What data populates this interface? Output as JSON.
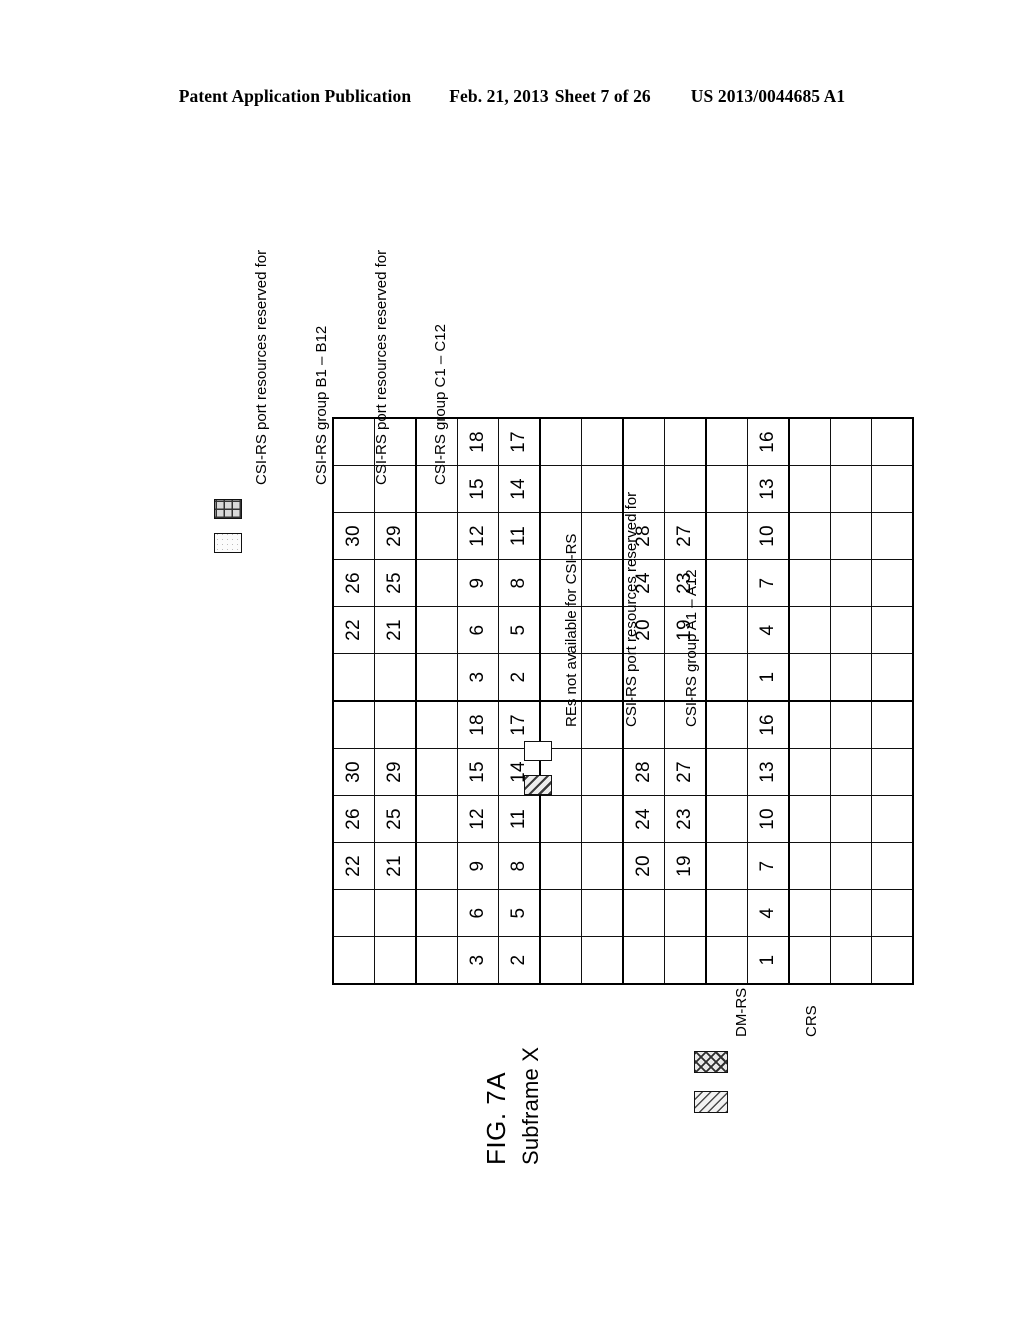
{
  "header": {
    "publication": "Patent Application Publication",
    "date": "Feb. 21, 2013",
    "sheet": "Sheet 7 of 26",
    "patent_number": "US 2013/0044685 A1"
  },
  "figure": {
    "label": "FIG. 7A",
    "subtitle": "Subframe X"
  },
  "legends": {
    "bc_group": {
      "lines": [
        "CSI-RS port resources reserved for",
        "CSI-RS group B1 – B12",
        "CSI-RS port resources reserved for",
        "CSI-RS group C1 – C12"
      ],
      "swatch_b": "light-speckle-swatch",
      "swatch_c": "fine-grid-swatch"
    },
    "na_group": {
      "lines": [
        "REs not available for CSI-RS",
        "CSI-RS port resources reserved for",
        "CSI-RS group A1 – A12"
      ],
      "swatch_na": "bold-diagonal-hatch-swatch",
      "swatch_a": "plain-white-swatch"
    },
    "reference_signals": {
      "items": [
        {
          "label": "DM-RS",
          "swatch": "diagonal-hatch-swatch"
        },
        {
          "label": "CRS",
          "swatch": "cross-hatch-swatch"
        }
      ]
    }
  },
  "grid": {
    "columns": 12,
    "rows_count": 14,
    "rows": [
      {
        "cells": [
          {
            "t": "",
            "p": "dmrs"
          },
          {
            "t": "",
            "p": "dmrs"
          },
          {
            "t": "22",
            "p": "plain"
          },
          {
            "t": "26",
            "p": "plain"
          },
          {
            "t": "30",
            "p": "plain"
          },
          {
            "t": "",
            "p": "dmrs"
          },
          {
            "t": "",
            "p": "dmrs"
          },
          {
            "t": "22",
            "p": "plain"
          },
          {
            "t": "26",
            "p": "plain"
          },
          {
            "t": "30",
            "p": "plain"
          },
          {
            "t": "",
            "p": "dmrs"
          },
          {
            "t": "",
            "p": "dmrs"
          }
        ]
      },
      {
        "cells": [
          {
            "t": "",
            "p": "dmrs"
          },
          {
            "t": "",
            "p": "dmrs"
          },
          {
            "t": "21",
            "p": "plain"
          },
          {
            "t": "25",
            "p": "plain"
          },
          {
            "t": "29",
            "p": "plain"
          },
          {
            "t": "",
            "p": "dmrs"
          },
          {
            "t": "",
            "p": "dmrs"
          },
          {
            "t": "21",
            "p": "plain"
          },
          {
            "t": "25",
            "p": "plain"
          },
          {
            "t": "29",
            "p": "plain"
          },
          {
            "t": "",
            "p": "dmrs"
          },
          {
            "t": "",
            "p": "dmrs"
          }
        ]
      },
      {
        "cells": [
          {
            "t": "",
            "p": "plain"
          },
          {
            "t": "",
            "p": "crs"
          },
          {
            "t": "",
            "p": "plain"
          },
          {
            "t": "",
            "p": "plain"
          },
          {
            "t": "",
            "p": "crs"
          },
          {
            "t": "",
            "p": "plain"
          },
          {
            "t": "",
            "p": "plain"
          },
          {
            "t": "",
            "p": "crs"
          },
          {
            "t": "",
            "p": "plain"
          },
          {
            "t": "",
            "p": "plain"
          },
          {
            "t": "",
            "p": "crs"
          },
          {
            "t": "",
            "p": "plain"
          }
        ]
      },
      {
        "cells": [
          {
            "t": "3",
            "p": "plain"
          },
          {
            "t": "6",
            "p": "plain"
          },
          {
            "t": "9",
            "p": "plain"
          },
          {
            "t": "12",
            "p": "plain"
          },
          {
            "t": "15",
            "p": "plain"
          },
          {
            "t": "18",
            "p": "plain"
          },
          {
            "t": "3",
            "p": "plain"
          },
          {
            "t": "6",
            "p": "plain"
          },
          {
            "t": "9",
            "p": "plain"
          },
          {
            "t": "12",
            "p": "plain"
          },
          {
            "t": "15",
            "p": "plain"
          },
          {
            "t": "18",
            "p": "plain"
          }
        ]
      },
      {
        "cells": [
          {
            "t": "2",
            "p": "plain"
          },
          {
            "t": "5",
            "p": "plain"
          },
          {
            "t": "8",
            "p": "plain"
          },
          {
            "t": "11",
            "p": "plain"
          },
          {
            "t": "14",
            "p": "plain"
          },
          {
            "t": "17",
            "p": "plain"
          },
          {
            "t": "2",
            "p": "plain"
          },
          {
            "t": "5",
            "p": "plain"
          },
          {
            "t": "8",
            "p": "plain"
          },
          {
            "t": "11",
            "p": "plain"
          },
          {
            "t": "14",
            "p": "plain"
          },
          {
            "t": "17",
            "p": "plain"
          }
        ]
      },
      {
        "cells": [
          {
            "t": "",
            "p": "plain"
          },
          {
            "t": "",
            "p": "crs"
          },
          {
            "t": "",
            "p": "plain"
          },
          {
            "t": "",
            "p": "plain"
          },
          {
            "t": "",
            "p": "crs"
          },
          {
            "t": "",
            "p": "plain"
          },
          {
            "t": "",
            "p": "plain"
          },
          {
            "t": "",
            "p": "crs"
          },
          {
            "t": "",
            "p": "plain"
          },
          {
            "t": "",
            "p": "plain"
          },
          {
            "t": "",
            "p": "crs"
          },
          {
            "t": "",
            "p": "plain"
          }
        ]
      },
      {
        "cells": [
          {
            "t": "",
            "p": "tint"
          },
          {
            "t": "",
            "p": "crs"
          },
          {
            "t": "",
            "p": "tint"
          },
          {
            "t": "",
            "p": "tint"
          },
          {
            "t": "",
            "p": "crs"
          },
          {
            "t": "",
            "p": "tint"
          },
          {
            "t": "",
            "p": "tint"
          },
          {
            "t": "",
            "p": "crs"
          },
          {
            "t": "",
            "p": "tint"
          },
          {
            "t": "",
            "p": "tint"
          },
          {
            "t": "",
            "p": "crs"
          },
          {
            "t": "",
            "p": "tint"
          }
        ]
      },
      {
        "cells": [
          {
            "t": "",
            "p": "na"
          },
          {
            "t": "",
            "p": "na"
          },
          {
            "t": "20",
            "p": "plain"
          },
          {
            "t": "24",
            "p": "plain"
          },
          {
            "t": "28",
            "p": "plain"
          },
          {
            "t": "",
            "p": "na"
          },
          {
            "t": "",
            "p": "na"
          },
          {
            "t": "20",
            "p": "plain"
          },
          {
            "t": "24",
            "p": "plain"
          },
          {
            "t": "28",
            "p": "plain"
          },
          {
            "t": "",
            "p": "na"
          },
          {
            "t": "",
            "p": "na"
          }
        ]
      },
      {
        "cells": [
          {
            "t": "",
            "p": "na"
          },
          {
            "t": "",
            "p": "na"
          },
          {
            "t": "19",
            "p": "plain"
          },
          {
            "t": "23",
            "p": "plain"
          },
          {
            "t": "27",
            "p": "plain"
          },
          {
            "t": "",
            "p": "na"
          },
          {
            "t": "",
            "p": "na"
          },
          {
            "t": "19",
            "p": "plain"
          },
          {
            "t": "23",
            "p": "plain"
          },
          {
            "t": "27",
            "p": "plain"
          },
          {
            "t": "",
            "p": "na"
          },
          {
            "t": "",
            "p": "na"
          }
        ]
      },
      {
        "cells": [
          {
            "t": "",
            "p": "plain"
          },
          {
            "t": "",
            "p": "crs"
          },
          {
            "t": "",
            "p": "plain"
          },
          {
            "t": "",
            "p": "plain"
          },
          {
            "t": "",
            "p": "crs"
          },
          {
            "t": "",
            "p": "plain"
          },
          {
            "t": "",
            "p": "plain"
          },
          {
            "t": "",
            "p": "crs"
          },
          {
            "t": "",
            "p": "plain"
          },
          {
            "t": "",
            "p": "plain"
          },
          {
            "t": "",
            "p": "crs"
          },
          {
            "t": "",
            "p": "plain"
          }
        ]
      },
      {
        "cells": [
          {
            "t": "1",
            "p": "plain"
          },
          {
            "t": "4",
            "p": "plain"
          },
          {
            "t": "7",
            "p": "plain"
          },
          {
            "t": "10",
            "p": "plain"
          },
          {
            "t": "13",
            "p": "plain"
          },
          {
            "t": "16",
            "p": "plain"
          },
          {
            "t": "1",
            "p": "plain"
          },
          {
            "t": "4",
            "p": "plain"
          },
          {
            "t": "7",
            "p": "plain"
          },
          {
            "t": "10",
            "p": "plain"
          },
          {
            "t": "13",
            "p": "plain"
          },
          {
            "t": "16",
            "p": "plain"
          }
        ]
      },
      {
        "cells": [
          {
            "t": "",
            "p": "tint"
          },
          {
            "t": "",
            "p": "tint"
          },
          {
            "t": "",
            "p": "tint"
          },
          {
            "t": "",
            "p": "tint"
          },
          {
            "t": "",
            "p": "tint"
          },
          {
            "t": "",
            "p": "tint"
          },
          {
            "t": "",
            "p": "tint"
          },
          {
            "t": "",
            "p": "tint"
          },
          {
            "t": "",
            "p": "tint"
          },
          {
            "t": "",
            "p": "tint"
          },
          {
            "t": "",
            "p": "tint"
          },
          {
            "t": "",
            "p": "tint"
          }
        ]
      },
      {
        "cells": [
          {
            "t": "",
            "p": "tint"
          },
          {
            "t": "",
            "p": "crs"
          },
          {
            "t": "",
            "p": "tint"
          },
          {
            "t": "",
            "p": "tint"
          },
          {
            "t": "",
            "p": "crs"
          },
          {
            "t": "",
            "p": "tint"
          },
          {
            "t": "",
            "p": "tint"
          },
          {
            "t": "",
            "p": "crs"
          },
          {
            "t": "",
            "p": "tint"
          },
          {
            "t": "",
            "p": "tint"
          },
          {
            "t": "",
            "p": "crs"
          },
          {
            "t": "",
            "p": "tint"
          }
        ]
      },
      {
        "cells": [
          {
            "t": "",
            "p": "tint"
          },
          {
            "t": "",
            "p": "crs"
          },
          {
            "t": "",
            "p": "tint"
          },
          {
            "t": "",
            "p": "tint"
          },
          {
            "t": "",
            "p": "crs"
          },
          {
            "t": "",
            "p": "tint"
          },
          {
            "t": "",
            "p": "tint"
          },
          {
            "t": "",
            "p": "crs"
          },
          {
            "t": "",
            "p": "tint"
          },
          {
            "t": "",
            "p": "tint"
          },
          {
            "t": "",
            "p": "crs"
          },
          {
            "t": "",
            "p": "tint"
          }
        ]
      }
    ]
  }
}
